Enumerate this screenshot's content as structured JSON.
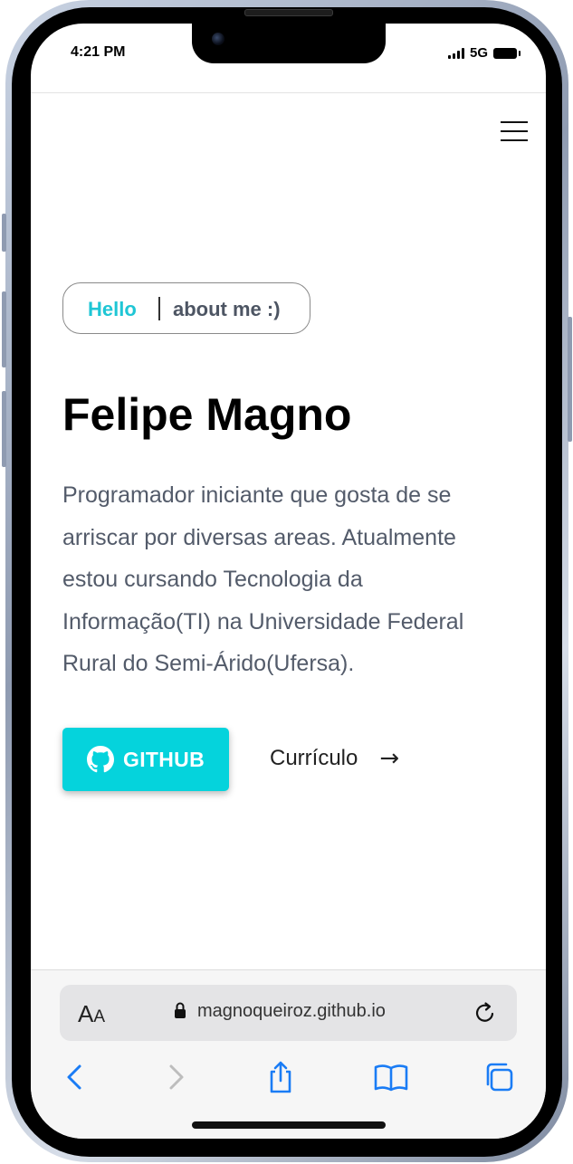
{
  "status_bar": {
    "time": "4:21 PM",
    "network": "5G"
  },
  "header": {
    "menu_icon": "hamburger-menu-icon"
  },
  "intro": {
    "hello": "Hello",
    "about": "about me :)"
  },
  "profile": {
    "name": "Felipe Magno",
    "bio": "Programador iniciante que gosta de se arriscar por diversas areas. Atualmente estou cursando Tecnologia da Informação(TI) na Universidade Federal Rural do Semi-Árido(Ufersa)."
  },
  "actions": {
    "github_label": "GITHUB",
    "github_icon": "github-icon",
    "curriculo_label": "Currículo",
    "curriculo_arrow": "→"
  },
  "browser": {
    "aa_big": "A",
    "aa_small": "A",
    "url": "magnoqueiroz.github.io",
    "icons": [
      "back-icon",
      "forward-icon",
      "share-icon",
      "bookmarks-icon",
      "tabs-icon"
    ]
  },
  "colors": {
    "accent": "#05d3dc",
    "hello": "#1fc6d5",
    "body_text": "#535b6a",
    "safari_blue": "#1a7cf5"
  }
}
